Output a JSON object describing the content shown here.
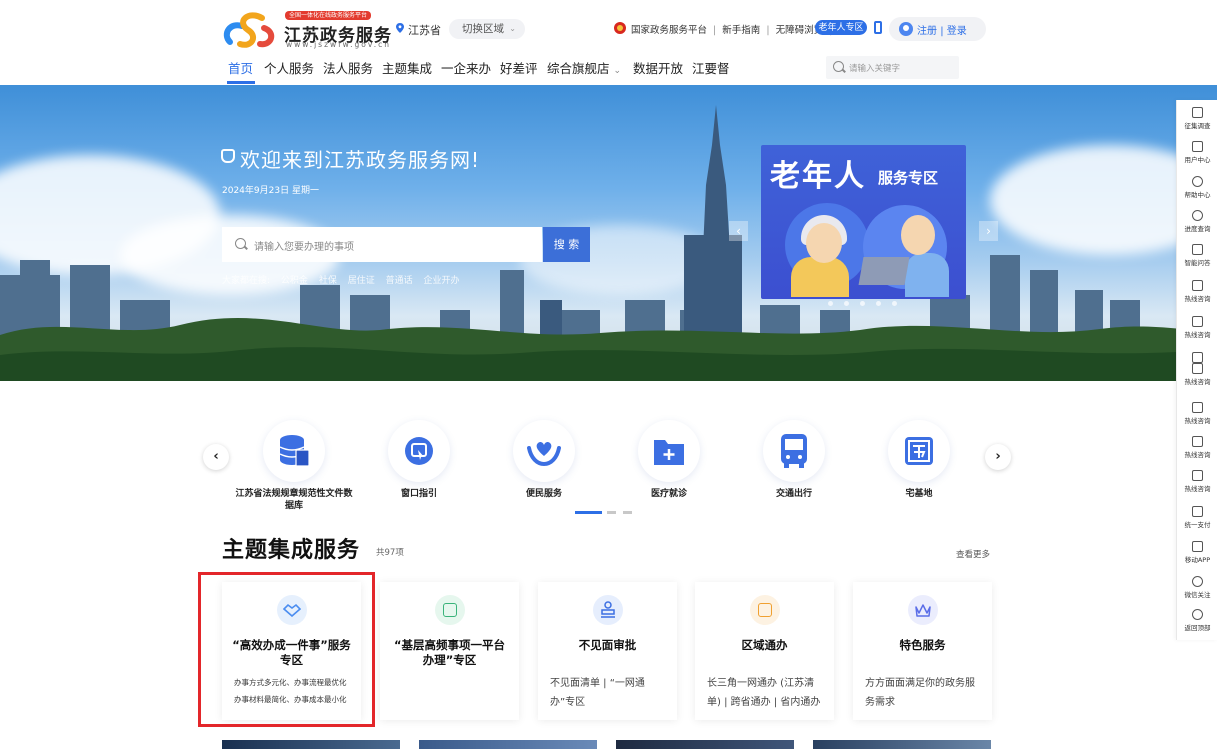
{
  "header": {
    "logo_badge": "全国一体化在线政务服务平台",
    "logo_title": "江苏政务服务",
    "logo_url": "www.jszwfw.gov.cn",
    "region": "江苏省",
    "region_switch": "切换区域",
    "top_links": [
      "国家政务服务平台",
      "新手指南",
      "无障碍浏览"
    ],
    "elder_zone": "老年人专区",
    "register": "注册",
    "login": "登录",
    "nav": [
      "首页",
      "个人服务",
      "法人服务",
      "主题集成",
      "一企来办",
      "好差评",
      "综合旗舰店",
      "数据开放",
      "江要督"
    ],
    "nav_active": "首页",
    "search_placeholder": "请输入关键字"
  },
  "banner": {
    "welcome": "欢迎来到江苏政务服务网!",
    "date": "2024年9月23日 星期一",
    "search_placeholder": "请输入您要办理的事项",
    "search_button": "搜 索",
    "hot_label": "大家都在搜:",
    "hot_terms": [
      "公积金",
      "社保",
      "居住证",
      "普通话",
      "企业开办"
    ],
    "promo_title_big": "老年人",
    "promo_title_small": "服务专区",
    "carousel_dots": 5
  },
  "services": {
    "items": [
      {
        "label": "江苏省法规规章规范性文件数据库",
        "icon": "database-icon"
      },
      {
        "label": "窗口指引",
        "icon": "window-guide-icon"
      },
      {
        "label": "便民服务",
        "icon": "heart-hands-icon"
      },
      {
        "label": "医疗就诊",
        "icon": "medical-folder-icon"
      },
      {
        "label": "交通出行",
        "icon": "bus-icon"
      },
      {
        "label": "宅基地",
        "icon": "homestead-icon"
      }
    ]
  },
  "theme": {
    "title": "主题集成服务",
    "count": "共97项",
    "more": "查看更多",
    "cards": [
      {
        "title": "“高效办成一件事”服务专区",
        "desc": [
          "办事方式多元化、办事流程最优化",
          "办事材料最简化、办事成本最小化"
        ],
        "icon": "handshake-icon",
        "color": "#4b8df0"
      },
      {
        "title": "“基层高频事项一平台办理”专区",
        "desc": [],
        "icon": "document-icon",
        "color": "#3ab37a"
      },
      {
        "title": "不见面审批",
        "desc": [
          "不见面清单 | “一网通办”专区"
        ],
        "icon": "stamp-icon",
        "color": "#3c6fe2"
      },
      {
        "title": "区域通办",
        "desc": [
          "长三角一网通办 (江苏清单) | 跨省通办 | 省内通办"
        ],
        "icon": "region-icon",
        "color": "#f0a030"
      },
      {
        "title": "特色服务",
        "desc": [
          "方方面面满足你的政务服务需求"
        ],
        "icon": "crown-icon",
        "color": "#5b6ee8"
      }
    ]
  },
  "toolbar": {
    "items": [
      {
        "label": "征集调查",
        "icon": "survey-icon"
      },
      {
        "label": "用户中心",
        "icon": "user-center-icon"
      },
      {
        "label": "帮助中心",
        "icon": "help-icon"
      },
      {
        "label": "进度查询",
        "icon": "progress-icon"
      },
      {
        "label": "智能问答",
        "icon": "robot-icon"
      },
      {
        "label": "热线咨询",
        "icon": "hotline-icon"
      },
      {
        "label": "热线咨询",
        "icon": "hotline-icon"
      },
      {
        "label": "热线咨询",
        "icon": "hotline-icon"
      },
      {
        "label": "热线咨询",
        "icon": "hotline-icon"
      },
      {
        "label": "热线咨询",
        "icon": "hotline-icon"
      },
      {
        "label": "热线咨询",
        "icon": "hotline-icon"
      },
      {
        "label": "统一支付",
        "icon": "wallet-icon"
      },
      {
        "label": "移动APP",
        "icon": "mobile-app-icon"
      },
      {
        "label": "微信关注",
        "icon": "wechat-icon"
      },
      {
        "label": "返回顶部",
        "icon": "back-to-top-icon"
      }
    ]
  },
  "colors": {
    "primary": "#2d6fe6",
    "highlight_border": "#e3262a"
  }
}
